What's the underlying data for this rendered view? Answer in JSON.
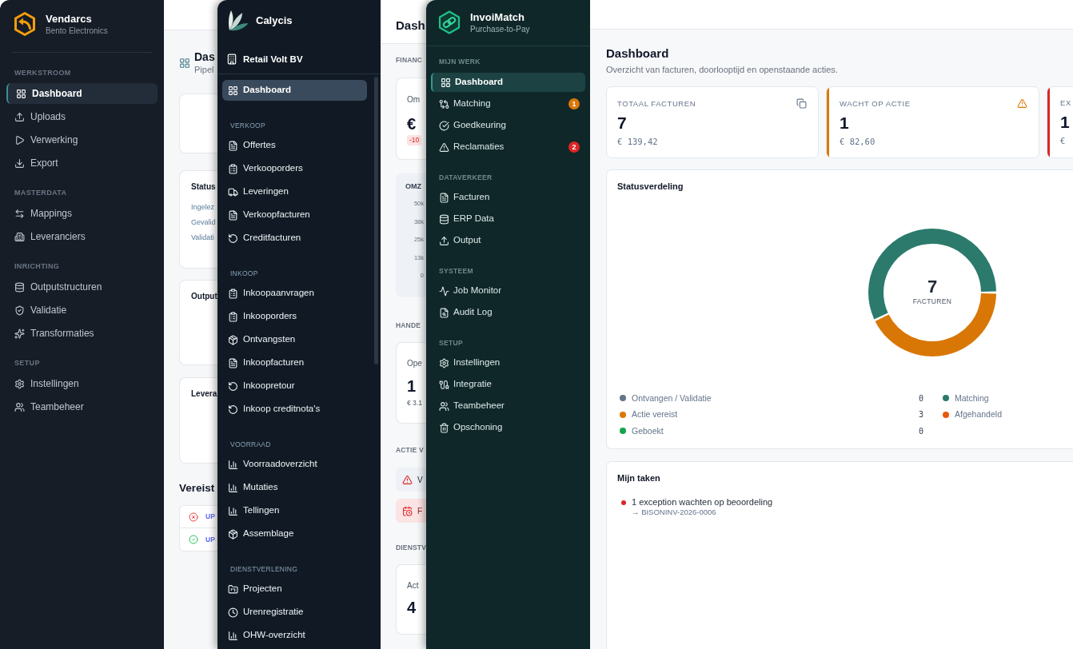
{
  "vendarcs": {
    "sidebar": {
      "app_name": "Vendarcs",
      "organization": "Bento Electronics",
      "sections": [
        {
          "title": "WERKSTROOM",
          "items": [
            {
              "label": "Dashboard",
              "selected": true
            },
            {
              "label": "Uploads",
              "selected": false
            },
            {
              "label": "Verwerking",
              "selected": false
            },
            {
              "label": "Export",
              "selected": false
            }
          ]
        },
        {
          "title": "MASTERDATA",
          "items": [
            {
              "label": "Mappings",
              "selected": false
            },
            {
              "label": "Leveranciers",
              "selected": false
            }
          ]
        },
        {
          "title": "INRICHTING",
          "items": [
            {
              "label": "Outputstructuren",
              "selected": false
            },
            {
              "label": "Validatie",
              "selected": false
            },
            {
              "label": "Transformaties",
              "selected": false
            }
          ]
        },
        {
          "title": "SETUP",
          "items": [
            {
              "label": "Instellingen",
              "selected": false
            },
            {
              "label": "Teambeheer",
              "selected": false
            }
          ]
        }
      ]
    },
    "main": {
      "title": "Das",
      "subtitle": "Pipel",
      "panels": [
        {
          "title": "Status",
          "lines": [
            "Ingelez",
            "Gevalid",
            "Validati"
          ]
        },
        {
          "title": "Output"
        },
        {
          "title": "Levera"
        }
      ],
      "requirements": {
        "title": "Vereist",
        "rows": [
          {
            "kind": "error",
            "text": "UP"
          },
          {
            "kind": "success",
            "text": "UP"
          }
        ]
      }
    }
  },
  "calycis": {
    "sidebar": {
      "app_name": "Calycis",
      "organization": "Retail Volt BV",
      "top_items": [
        {
          "label": "Dashboard",
          "selected": true
        }
      ],
      "sections": [
        {
          "title": "VERKOOP",
          "items": [
            {
              "label": "Offertes",
              "selected": false
            },
            {
              "label": "Verkooporders",
              "selected": false
            },
            {
              "label": "Leveringen",
              "selected": false
            },
            {
              "label": "Verkoopfacturen",
              "selected": false
            },
            {
              "label": "Creditfacturen",
              "selected": false
            }
          ]
        },
        {
          "title": "INKOOP",
          "items": [
            {
              "label": "Inkoopaanvragen",
              "selected": false
            },
            {
              "label": "Inkooporders",
              "selected": false
            },
            {
              "label": "Ontvangsten",
              "selected": false
            },
            {
              "label": "Inkoopfacturen",
              "selected": false
            },
            {
              "label": "Inkoopretour",
              "selected": false
            },
            {
              "label": "Inkoop creditnota's",
              "selected": false
            }
          ]
        },
        {
          "title": "VOORRAAD",
          "items": [
            {
              "label": "Voorraadoverzicht",
              "selected": false
            },
            {
              "label": "Mutaties",
              "selected": false
            },
            {
              "label": "Tellingen",
              "selected": false
            },
            {
              "label": "Assemblage",
              "selected": false
            }
          ]
        },
        {
          "title": "DIENSTVERLENING",
          "items": [
            {
              "label": "Projecten",
              "selected": false
            },
            {
              "label": "Urenregistratie",
              "selected": false
            },
            {
              "label": "OHW-overzicht",
              "selected": false
            }
          ]
        }
      ]
    },
    "main": {
      "title": "Dash",
      "finance": {
        "label": "FINANC",
        "card": {
          "label": "Om",
          "value": "€",
          "delta": "-10"
        },
        "chart": {
          "title": "OMZ",
          "tick_labels": [
            "50k",
            "38k",
            "25k",
            "13k",
            "0"
          ]
        }
      },
      "trade": {
        "label": "HANDE",
        "card": {
          "label": "Ope",
          "value": "1",
          "amount": "€ 3.1"
        }
      },
      "actions": {
        "label": "ACTIE V",
        "items": [
          {
            "kind": "warning",
            "text": "V"
          },
          {
            "kind": "urgent",
            "text": "F"
          }
        ]
      },
      "services": {
        "label": "DIENSTV",
        "card": {
          "label": "Act",
          "value": "4"
        }
      }
    }
  },
  "invoimatch": {
    "sidebar": {
      "app_name": "InvoiMatch",
      "tagline": "Purchase-to-Pay",
      "sections": [
        {
          "title": "MIJN WERK",
          "items": [
            {
              "label": "Dashboard",
              "selected": true
            },
            {
              "label": "Matching",
              "selected": false,
              "badge": {
                "text": "1",
                "color": "#d97706"
              }
            },
            {
              "label": "Goedkeuring",
              "selected": false
            },
            {
              "label": "Reclamaties",
              "selected": false,
              "badge": {
                "text": "2",
                "color": "#dc2626"
              }
            }
          ]
        },
        {
          "title": "DATAVERKEER",
          "items": [
            {
              "label": "Facturen",
              "selected": false
            },
            {
              "label": "ERP Data",
              "selected": false
            },
            {
              "label": "Output",
              "selected": false
            }
          ]
        },
        {
          "title": "SYSTEEM",
          "items": [
            {
              "label": "Job Monitor",
              "selected": false
            },
            {
              "label": "Audit Log",
              "selected": false
            }
          ]
        },
        {
          "title": "SETUP",
          "items": [
            {
              "label": "Instellingen",
              "selected": false
            },
            {
              "label": "Integratie",
              "selected": false
            },
            {
              "label": "Teambeheer",
              "selected": false
            },
            {
              "label": "Opschoning",
              "selected": false
            }
          ]
        }
      ]
    },
    "main": {
      "title": "Dashboard",
      "subtitle": "Overzicht van facturen, doorlooptijd en openstaande acties.",
      "stat_cards": [
        {
          "label": "TOTAAL FACTUREN",
          "value": "7",
          "amount": "€ 139,42"
        },
        {
          "label": "WACHT OP ACTIE",
          "value": "1",
          "amount": "€ 82,60",
          "color": "#d97706"
        },
        {
          "label": "EX",
          "value": "1",
          "amount": "€",
          "color": "#dc2626"
        }
      ],
      "status_distribution": {
        "title": "Statusverdeling",
        "total": "7",
        "total_label": "FACTUREN",
        "chart_data": {
          "type": "donut",
          "categories": [
            "Ontvangen / Validatie",
            "Matching",
            "Actie vereist",
            "Afgehandeld",
            "Geboekt"
          ],
          "values": [
            0,
            57.14,
            42.86,
            0,
            0
          ]
        },
        "legend": [
          {
            "color": "#64748b",
            "count": "0"
          },
          {
            "color": "#2b7a6c"
          },
          {
            "color": "#d97706",
            "count": "3"
          },
          {
            "color": "#ea580c"
          },
          {
            "color": "#16a34a",
            "count": "0"
          }
        ]
      },
      "tasks": {
        "title": "Mijn taken",
        "items": [
          {
            "text": "1 exception wachten op beoordeling",
            "reference": "→ BISONINV-2026-0006",
            "color": "#dc2626"
          }
        ]
      }
    }
  }
}
